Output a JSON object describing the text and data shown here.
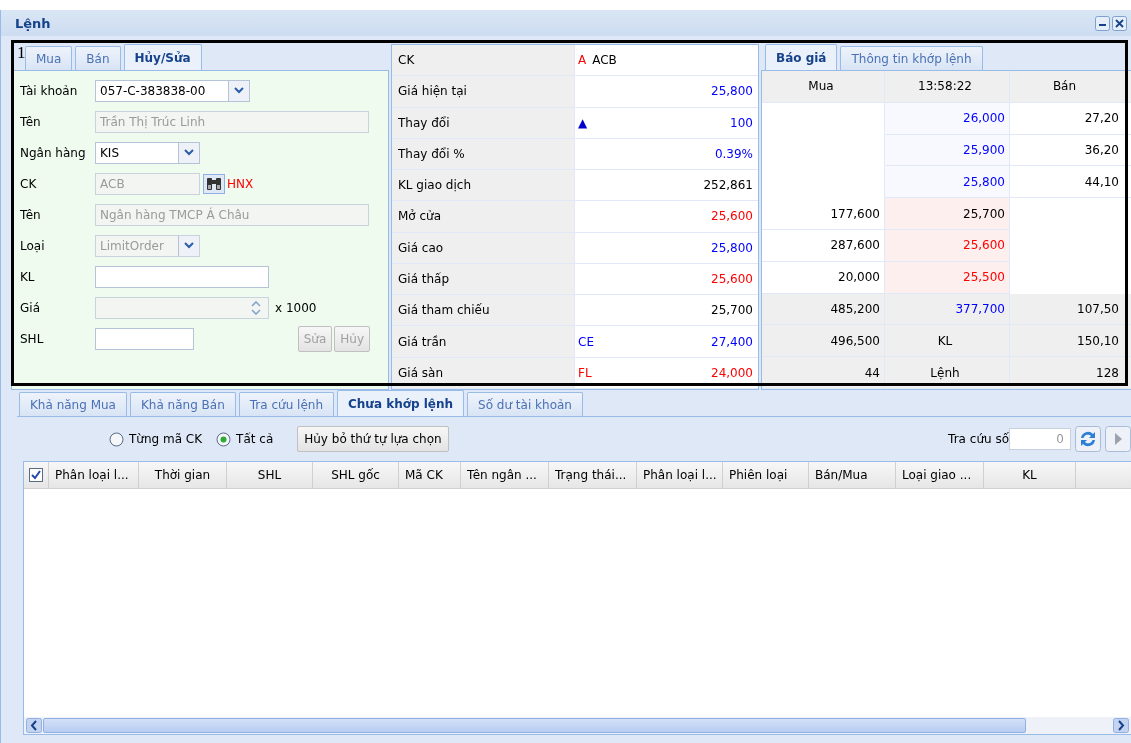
{
  "window": {
    "title": "Lệnh"
  },
  "annotation": {
    "label": "1"
  },
  "order_panel": {
    "tabs": [
      {
        "label": "Mua",
        "selected": false
      },
      {
        "label": "Bán",
        "selected": false
      },
      {
        "label": "Hủy/Sửa",
        "selected": true
      }
    ],
    "fields": [
      {
        "kind": "select",
        "label": "Tài khoản",
        "value": "057-C-383838-00",
        "disabled": false
      },
      {
        "kind": "text",
        "label": "Tên",
        "value": "Trần Thị Trúc Linh",
        "disabled": true
      },
      {
        "kind": "select",
        "label": "Ngân hàng",
        "value": "KIS",
        "disabled": false
      },
      {
        "kind": "lookup",
        "label": "CK",
        "value": "ACB",
        "disabled": true,
        "exchange": "HNX"
      },
      {
        "kind": "text",
        "label": "Tên",
        "value": "Ngân hàng TMCP Á Châu",
        "disabled": true
      },
      {
        "kind": "select",
        "label": "Loại",
        "value": "LimitOrder",
        "disabled": true
      },
      {
        "kind": "text",
        "label": "KL",
        "disabled": false
      },
      {
        "kind": "spinner",
        "label": "Giá",
        "suffix": "x 1000",
        "disabled": true
      },
      {
        "kind": "text",
        "label": "SHL",
        "disabled": false
      }
    ],
    "buttons": [
      {
        "label": "Sửa",
        "disabled": true
      },
      {
        "label": "Hủy",
        "disabled": true
      }
    ]
  },
  "stock_info": {
    "rows": [
      {
        "label": "CK",
        "marker": {
          "text": "A",
          "color": "#ff0000"
        },
        "value": "ACB",
        "color": "#000000",
        "kind": "symbol"
      },
      {
        "label": "Giá hiện tại",
        "value": "25,800",
        "color": "#0000ff"
      },
      {
        "label": "Thay đổi",
        "marker": {
          "text": "▲",
          "color": "#0000cc"
        },
        "value": "100",
        "color": "#0000ff"
      },
      {
        "label": "Thay đổi %",
        "value": "0.39%",
        "color": "#0000ff"
      },
      {
        "label": "KL giao dịch",
        "value": "252,861",
        "color": "#000000"
      },
      {
        "label": "Mở cửa",
        "value": "25,600",
        "color": "#ff0000"
      },
      {
        "label": "Giá cao",
        "value": "25,800",
        "color": "#0000ff"
      },
      {
        "label": "Giá thấp",
        "value": "25,600",
        "color": "#ff0000"
      },
      {
        "label": "Giá tham chiếu",
        "value": "25,700",
        "color": "#000000"
      },
      {
        "label": "Giá trần",
        "marker": {
          "text": "CE",
          "color": "#0000ff"
        },
        "value": "27,400",
        "color": "#0000ff"
      },
      {
        "label": "Giá sàn",
        "marker": {
          "text": "FL",
          "color": "#ff0000"
        },
        "value": "24,000",
        "color": "#ff0000"
      }
    ]
  },
  "quote_panel": {
    "tabs": [
      {
        "label": "Báo giá",
        "selected": true
      },
      {
        "label": "Thông tin khớp lệnh",
        "selected": false
      }
    ],
    "header": [
      "Mua",
      "13:58:22",
      "Bán"
    ],
    "rows": [
      {
        "kind": "ask",
        "cells": [
          {},
          {
            "text": "26,000",
            "color": "#0000ff"
          },
          {
            "text": "27,20",
            "color": "#000000"
          }
        ]
      },
      {
        "kind": "ask",
        "cells": [
          {},
          {
            "text": "25,900",
            "color": "#0000ff"
          },
          {
            "text": "36,20",
            "color": "#000000"
          }
        ]
      },
      {
        "kind": "ask",
        "cells": [
          {},
          {
            "text": "25,800",
            "color": "#0000ff"
          },
          {
            "text": "44,10",
            "color": "#000000"
          }
        ]
      },
      {
        "kind": "bid",
        "cells": [
          {
            "text": "177,600",
            "color": "#000000"
          },
          {
            "text": "25,700",
            "color": "#000000"
          },
          {}
        ]
      },
      {
        "kind": "bid",
        "cells": [
          {
            "text": "287,600",
            "color": "#000000"
          },
          {
            "text": "25,600",
            "color": "#ff0000"
          },
          {}
        ]
      },
      {
        "kind": "bid",
        "cells": [
          {
            "text": "20,000",
            "color": "#000000"
          },
          {
            "text": "25,500",
            "color": "#ff0000"
          },
          {}
        ]
      },
      {
        "kind": "summary",
        "cells": [
          {
            "text": "485,200",
            "color": "#000000"
          },
          {
            "text": "377,700",
            "color": "#0000ff"
          },
          {
            "text": "107,50",
            "color": "#000000"
          }
        ]
      },
      {
        "kind": "summary",
        "cells": [
          {
            "text": "496,500",
            "color": "#000000"
          },
          {
            "text": "KL",
            "color": "#000000",
            "kind": "label"
          },
          {
            "text": "150,10",
            "color": "#000000"
          }
        ]
      },
      {
        "kind": "summary",
        "cells": [
          {
            "text": "44",
            "color": "#000000"
          },
          {
            "text": "Lệnh",
            "color": "#000000",
            "kind": "label"
          },
          {
            "text": "128",
            "color": "#000000"
          }
        ]
      }
    ]
  },
  "bottom_tabs": [
    {
      "label": "Khả năng Mua",
      "selected": false
    },
    {
      "label": "Khả năng Bán",
      "selected": false
    },
    {
      "label": "Tra cứu lệnh",
      "selected": false
    },
    {
      "label": "Chưa khớp lệnh",
      "selected": true
    },
    {
      "label": "Số dư tài khoản",
      "selected": false
    }
  ],
  "toolbar": {
    "radios": [
      {
        "label": "Từng mã CK",
        "selected": false
      },
      {
        "label": "Tất cả",
        "selected": true
      }
    ],
    "clear_button": "Hủy bỏ thứ tự lựa chọn",
    "lookup_label": "Tra cứu số",
    "lookup_value": "0"
  },
  "grid": {
    "select_all": {
      "checked": true
    },
    "columns": [
      "Phân loại l...",
      "Thời gian",
      "SHL",
      "SHL gốc",
      "Mã CK",
      "Tên ngân ...",
      "Trạng thái...",
      "Phân loại l...",
      "Phiên loại",
      "Bán/Mua",
      "Loại giao ...",
      "KL"
    ]
  }
}
